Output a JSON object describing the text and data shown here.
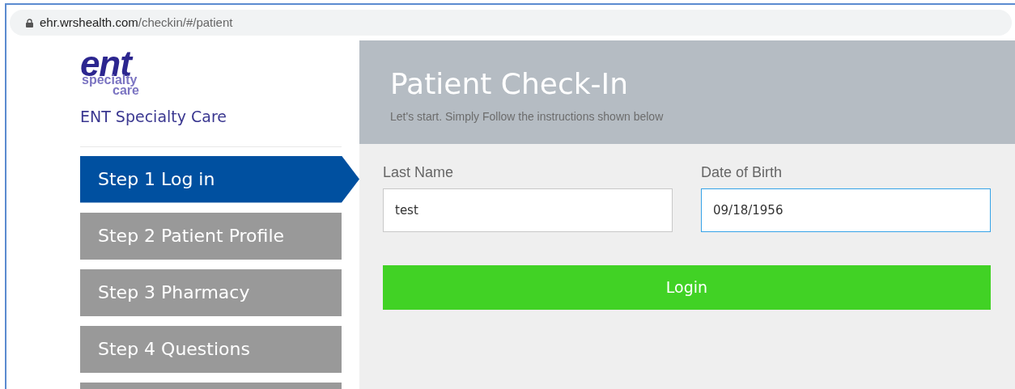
{
  "address_bar": {
    "domain": "ehr.wrshealth.com",
    "path": "/checkin/#/patient"
  },
  "logo": {
    "mark": "ent",
    "line_1": "specialty",
    "line_2": "care"
  },
  "practice_name": "ENT Specialty Care",
  "steps": [
    {
      "label": "Step 1 Log in",
      "selected": true
    },
    {
      "label": "Step 2 Patient Profile",
      "selected": false
    },
    {
      "label": "Step 3 Pharmacy",
      "selected": false
    },
    {
      "label": "Step 4 Questions",
      "selected": false
    },
    {
      "selected": false
    }
  ],
  "header": {
    "title": "Patient Check-In",
    "subtitle": "Let's start. Simply Follow the instructions shown below"
  },
  "fields": [
    {
      "label": "Last Name",
      "value": "test",
      "focused": false
    },
    {
      "label": "Date of Birth",
      "value": "09/18/1956",
      "focused": true
    }
  ],
  "login_button": "Login"
}
